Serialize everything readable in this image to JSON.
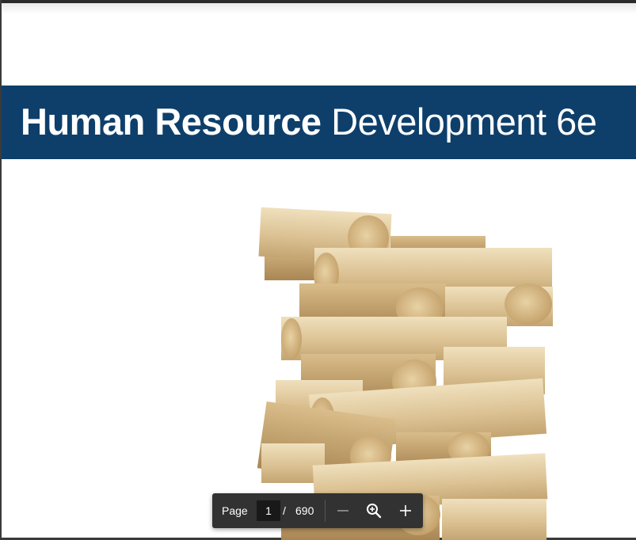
{
  "cover": {
    "title_bold": "Human Resource",
    "title_regular": "Development 6e",
    "band_color": "#0e3f6b"
  },
  "toolbar": {
    "page_label": "Page",
    "page_value": "1",
    "separator": "/",
    "total_pages": "690",
    "icons": [
      "zoom-out-icon",
      "zoom-fit-icon",
      "zoom-in-icon"
    ]
  }
}
